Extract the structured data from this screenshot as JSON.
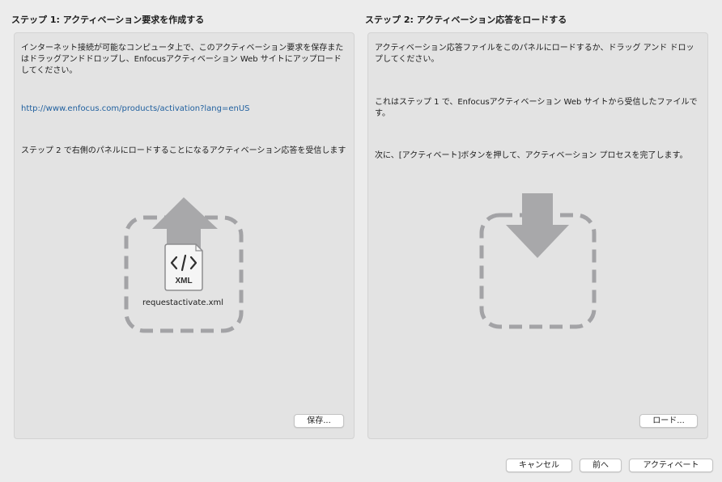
{
  "step1": {
    "title": "ステップ 1: アクティベーション要求を作成する",
    "paragraph1": "インターネット接続が可能なコンピュータ上で、このアクティベーション要求を保存またはドラッグアンドドロップし、Enfocusアクティベーション Web サイトにアップロードしてください。",
    "url": "http://www.enfocus.com/products/activation?lang=enUS",
    "paragraph2": "ステップ 2 で右側のパネルにロードすることになるアクティベーション応答を受信します",
    "file_badge": "XML",
    "file_name": "requestactivate.xml",
    "save_button": "保存..."
  },
  "step2": {
    "title": "ステップ 2: アクティベーション応答をロードする",
    "paragraph1": "アクティベーション応答ファイルをこのパネルにロードするか、ドラッグ アンド ドロップしてください。",
    "paragraph2": "これはステップ 1 で、Enfocusアクティベーション Web サイトから受信したファイルです。",
    "paragraph3": "次に、[アクティベート]ボタンを押して、アクティベーション プロセスを完了します。",
    "load_button": "ロード..."
  },
  "footer": {
    "cancel_button": "キャンセル",
    "back_button": "前へ",
    "activate_button": "アクティベート"
  },
  "icons": {
    "upload": "upload-arrow-icon",
    "download": "download-arrow-icon",
    "xml_file": "xml-file-icon"
  },
  "colors": {
    "dashed_border": "#a3a3a6",
    "arrow": "#a8a8aa",
    "link": "#1f5f9e"
  }
}
